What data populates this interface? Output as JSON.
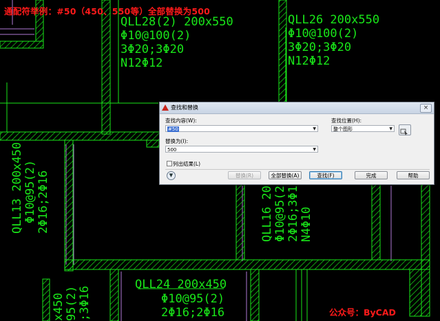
{
  "overlay": {
    "title": "通配符举例：#50（450、550等）全部替换为500",
    "brand": "公众号：ByCAD"
  },
  "drawing_labels": {
    "qll28": [
      "QLL28(2) 200x550",
      "Φ10@100(2)",
      "3Φ20;3Φ20",
      "N12Φ12"
    ],
    "qll26": [
      "QLL26 200x550",
      "Φ10@100(2)",
      "3Φ20;3Φ20",
      "N12Φ12"
    ],
    "qll13": [
      "QLL13 200x450",
      "Φ10@95(2)",
      "2Φ16;2Φ16"
    ],
    "qll16": [
      "QLL16 200",
      "Φ10@95(2",
      "2Φ16;3Φ1",
      "N4Φ10"
    ],
    "qll24": [
      "QLL24 200x450",
      "Φ10@95(2)",
      "2Φ16;2Φ16"
    ],
    "partial": [
      "x450",
      "95(2)",
      ";3Φ16"
    ]
  },
  "dialog": {
    "title": "查找和替换",
    "close": "×",
    "find_label": "查找内容(W):",
    "find_value": "#50",
    "replace_label": "替换为(I):",
    "replace_value": "500",
    "where_label": "查找位置(H):",
    "where_value": "整个图形",
    "list_results_label": "列出结果(L)",
    "buttons": {
      "replace": "替换(R)",
      "replace_all": "全部替换(A)",
      "find": "查找(F)",
      "done": "完成",
      "help": "帮助"
    }
  },
  "colors": {
    "background": "#000000",
    "drawing": "#19e619",
    "overlay_text": "#ff1a1a",
    "axis_lines": "#b07ad6"
  }
}
